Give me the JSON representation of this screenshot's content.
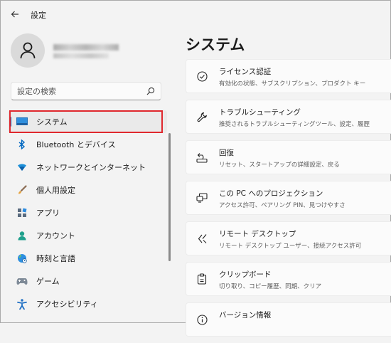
{
  "window": {
    "title": "設定"
  },
  "search": {
    "placeholder": "設定の検索"
  },
  "nav": [
    {
      "label": "システム",
      "icon": "monitor-icon"
    },
    {
      "label": "Bluetooth とデバイス",
      "icon": "bluetooth-icon"
    },
    {
      "label": "ネットワークとインターネット",
      "icon": "wifi-icon"
    },
    {
      "label": "個人用設定",
      "icon": "brush-icon"
    },
    {
      "label": "アプリ",
      "icon": "apps-icon"
    },
    {
      "label": "アカウント",
      "icon": "person-icon"
    },
    {
      "label": "時刻と言語",
      "icon": "globe-clock-icon"
    },
    {
      "label": "ゲーム",
      "icon": "gamepad-icon"
    },
    {
      "label": "アクセシビリティ",
      "icon": "accessibility-icon"
    }
  ],
  "page": {
    "title": "システム"
  },
  "cards": [
    {
      "title": "ライセンス認証",
      "subtitle": "有効化の状態、サブスクリプション、プロダクト キー",
      "icon": "check-circle-icon"
    },
    {
      "title": "トラブルシューティング",
      "subtitle": "推奨されるトラブルシューティングツール、設定、履歴",
      "icon": "wrench-icon"
    },
    {
      "title": "回復",
      "subtitle": "リセット、スタートアップの詳細設定、戻る",
      "icon": "recovery-icon"
    },
    {
      "title": "この PC へのプロジェクション",
      "subtitle": "アクセス許可、ペアリング PIN、見つけやすさ",
      "icon": "projection-icon"
    },
    {
      "title": "リモート デスクトップ",
      "subtitle": "リモート デスクトップ ユーザー、接続アクセス許可",
      "icon": "remote-desktop-icon"
    },
    {
      "title": "クリップボード",
      "subtitle": "切り取り、コピー履歴、同期、クリア",
      "icon": "clipboard-icon"
    },
    {
      "title": "バージョン情報",
      "subtitle": "",
      "icon": "info-icon"
    }
  ],
  "colors": {
    "accent": "#005fb8",
    "highlight_box": "#e0282e",
    "background": "#f3f3f3",
    "card": "#fbfbfb"
  }
}
